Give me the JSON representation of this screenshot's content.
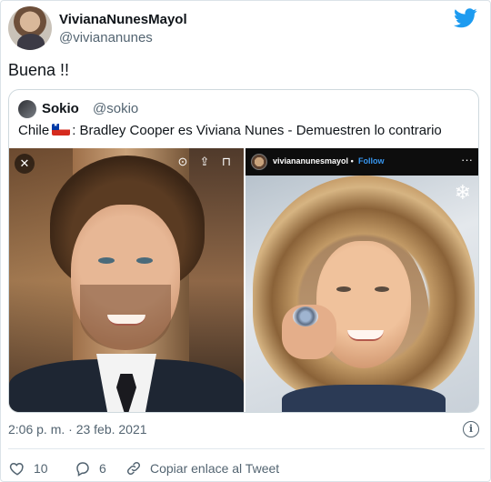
{
  "author": {
    "name": "VivianaNunesMayol",
    "handle": "@viviananunes"
  },
  "tweet": {
    "text": "Buena !!",
    "timestamp": "2:06 p. m. · 23 feb. 2021"
  },
  "quoted": {
    "name": "Sokio",
    "handle": "@sokio",
    "text_before_flag": "Chile",
    "text_after_flag": ": Bradley Cooper es Viviana Nunes - Demuestren lo contrario",
    "flag_icon": "chile-flag-icon",
    "right_image": {
      "ig_username": "viviananunesmayol",
      "ig_separator": "•",
      "ig_follow": "Follow",
      "ig_more": "···"
    }
  },
  "actions": {
    "likes": "10",
    "replies": "6",
    "copy_link_label": "Copiar enlace al Tweet"
  },
  "colors": {
    "brand": "#1d9bf0",
    "like": "#e0245e",
    "text_secondary": "#536471"
  }
}
